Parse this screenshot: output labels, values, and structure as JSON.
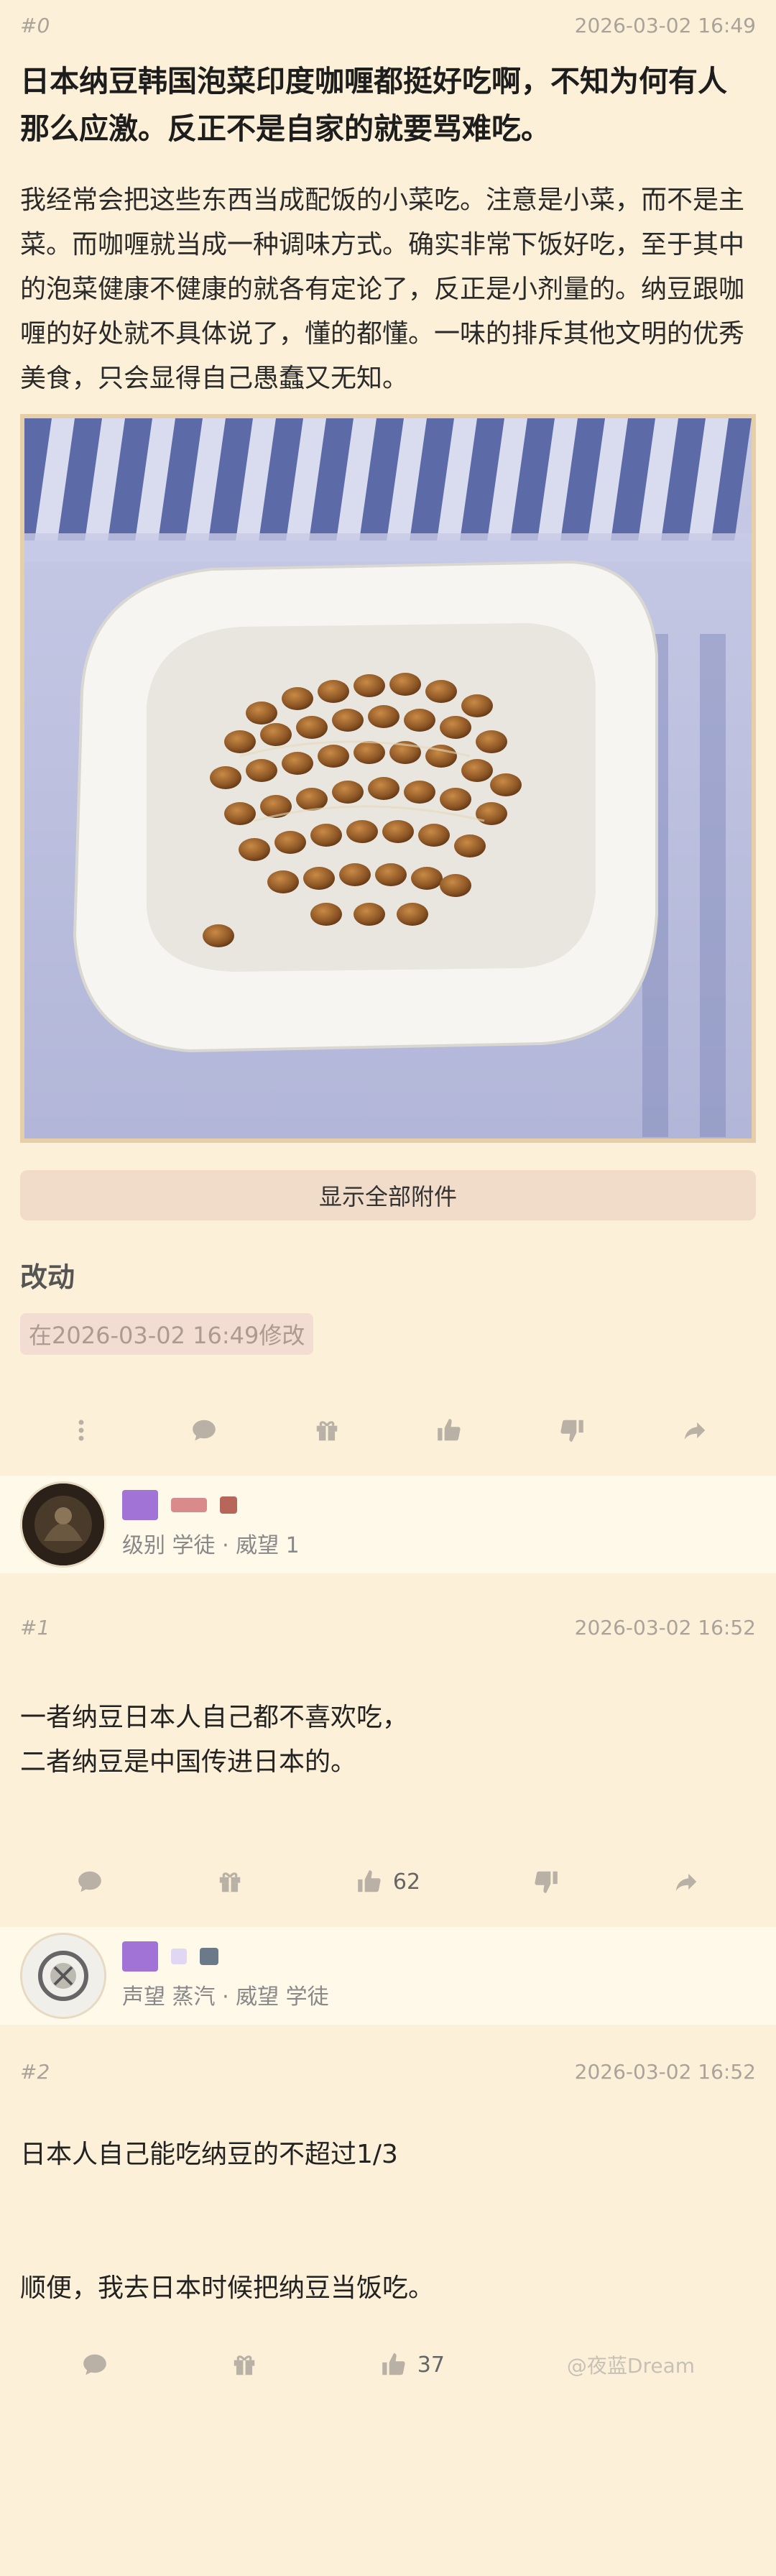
{
  "post": {
    "floor": "#0",
    "timestamp": "2026-03-02 16:49",
    "title": "日本纳豆韩国泡菜印度咖喱都挺好吃啊，不知为何有人那么应激。反正不是自家的就要骂难吃。",
    "body": "我经常会把这些东西当成配饭的小菜吃。注意是小菜，而不是主菜。而咖喱就当成一种调味方式。确实非常下饭好吃，至于其中的泡菜健康不健康的就各有定论了，反正是小剂量的。纳豆跟咖喱的好处就不具体说了，懂的都懂。一味的排斥其他文明的优秀美食，只会显得自己愚蠢又无知。",
    "show_all_label": "显示全部附件",
    "edit_label": "改动",
    "edit_note": "在2026-03-02 16:49修改"
  },
  "replies": [
    {
      "user_level": "级别 学徒 · 威望 1",
      "floor": "#1",
      "timestamp": "2026-03-02 16:52",
      "lines": [
        "一者纳豆日本人自己都不喜欢吃，",
        "二者纳豆是中国传进日本的。"
      ],
      "likes": "62"
    },
    {
      "user_level": "声望 蒸汽 · 威望 学徒",
      "floor": "#2",
      "timestamp": "2026-03-02 16:52",
      "lines": [
        "日本人自己能吃纳豆的不超过1/3",
        "",
        "",
        "顺便，我去日本时候把纳豆当饭吃。"
      ],
      "likes": "37"
    }
  ],
  "watermark": "@夜蓝Dream",
  "colors": {
    "background": "#fcf1d8",
    "user_band": "#fff9ea",
    "icon_gray": "#b9b1a6",
    "badge_purple": "#a173d6"
  },
  "icons": [
    "more-icon",
    "comment-icon",
    "gift-icon",
    "thumbs-up-icon",
    "thumbs-down-icon",
    "share-icon"
  ]
}
